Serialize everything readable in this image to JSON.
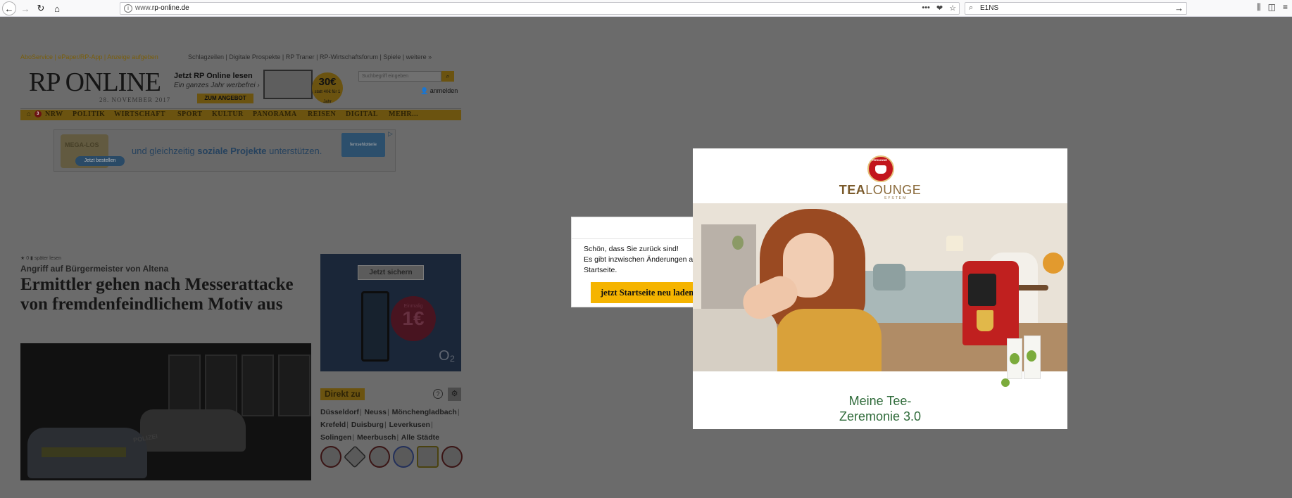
{
  "browser": {
    "url_prefix": "www.",
    "url_domain": "rp-online.de",
    "url_actions": [
      "•••",
      "❤",
      "☆"
    ],
    "search_value": "E1NS",
    "nav_icons": [
      "back-icon",
      "forward-icon",
      "reload-icon",
      "home-icon"
    ],
    "right_icons": [
      "library-icon",
      "sidebar-icon",
      "menu-icon"
    ]
  },
  "site": {
    "topnav_left": "AboService  |  ePaper/RP-App  |  Anzeige aufgeben",
    "topnav_right": "Schlagzeilen  |  Digitale Prospekte  |  RP Traner  |  RP-Wirtschaftsforum  |  Spiele  |  weitere »",
    "logo": "RP ONLINE",
    "date": "28. NOVEMBER 2017",
    "promo_headline": "Jetzt RP Online lesen",
    "promo_sub": "Ein ganzes Jahr werbefrei ›",
    "promo_button": "ZUM ANGEBOT",
    "promo_badge": "30€",
    "promo_badge_sub": "statt 40€ für 1 Jahr",
    "search_placeholder": "Suchbegriff eingeben",
    "login": "anmelden",
    "nav_badge": "3",
    "nav_items": [
      "NRW",
      "POLITIK",
      "WIRTSCHAFT",
      "SPORT",
      "KULTUR",
      "PANORAMA",
      "REISEN",
      "DIGITAL",
      "MEHR..."
    ],
    "ad_banner": {
      "mega": "MEGA-LOS",
      "order": "Jetzt bestellen",
      "text_pre": "und gleichzeitig",
      "text_bold": "soziale Projekte",
      "text_post": "unterstützen.",
      "partner": "fernsehlotterie"
    },
    "article_meta": "★ 0  ▮ später lesen",
    "kicker": "Angriff auf Bürgermeister von Altena",
    "headline": "Ermittler gehen nach Messerattacke von fremdenfeindlichem Motiv aus",
    "image_label": "POLIZEI",
    "side_ad": {
      "button": "Jetzt sichern",
      "coin_top": "Einmalig",
      "coin_value": "1€",
      "brand": "O₂"
    },
    "direkt_title": "Direkt zu",
    "direkt_links": [
      "Düsseldorf",
      "Neuss",
      "Mönchengladbach",
      "Krefeld",
      "Duisburg",
      "Leverkusen",
      "Solingen",
      "Meerbusch",
      "Alle Städte"
    ]
  },
  "notice": {
    "line1": "Schön, dass Sie zurück sind!",
    "line2": "Es gibt inzwischen Änderungen au",
    "line3": "Startseite.",
    "button": "jetzt Startseite neu laden"
  },
  "advert": {
    "brand_emblem": "TEEKANNE",
    "logo_bold": "TEA",
    "logo_rest": "LOUNGE",
    "logo_sub": "SYSTEM",
    "slogan_line1": "Meine Tee-",
    "slogan_line2": "Zeremonie 3.0"
  }
}
